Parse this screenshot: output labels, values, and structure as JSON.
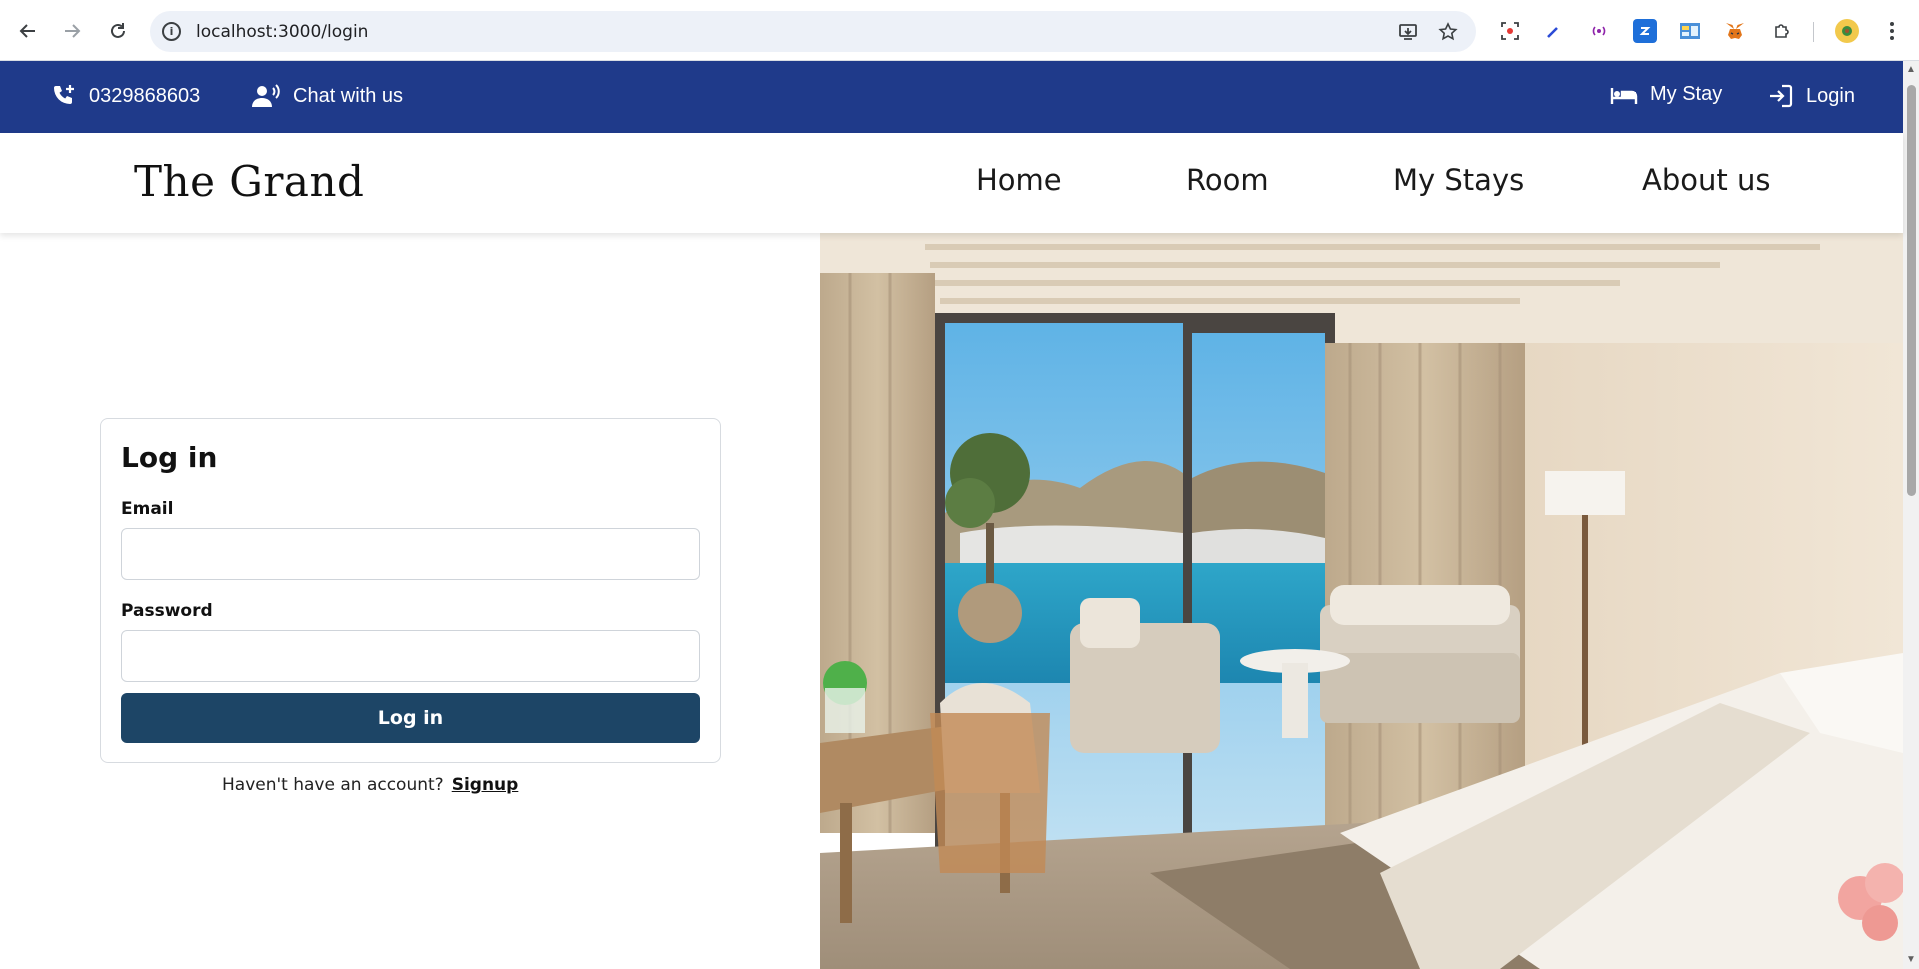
{
  "browser": {
    "url": "localhost:3000/login",
    "back_icon": "arrow-left-icon",
    "forward_icon": "arrow-right-icon",
    "reload_icon": "reload-icon"
  },
  "topbar": {
    "phone": "0329868603",
    "chat": "Chat with us",
    "my_stay": "My Stay",
    "login": "Login",
    "background": "#1f3a8a"
  },
  "header": {
    "logo": "The Grand",
    "menu": [
      "Home",
      "Room",
      "My Stays",
      "About us"
    ]
  },
  "login_form": {
    "title": "Log in",
    "email_label": "Email",
    "email_value": "",
    "password_label": "Password",
    "password_value": "",
    "submit_label": "Log in",
    "button_color": "#1d4566"
  },
  "signup": {
    "prompt": "Haven't have an account?",
    "link": "Signup"
  }
}
